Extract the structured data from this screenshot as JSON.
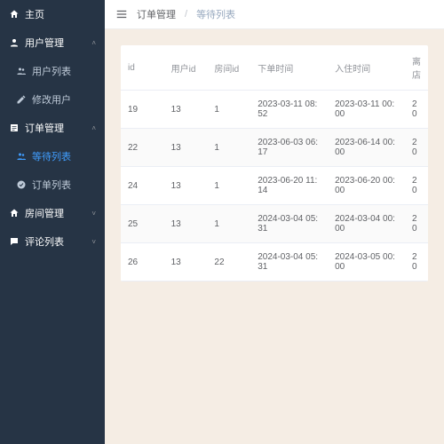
{
  "sidebar": {
    "home": "主页",
    "userMgmt": "用户管理",
    "userList": "用户列表",
    "editUser": "修改用户",
    "orderMgmt": "订单管理",
    "waitList": "等待列表",
    "orderList": "订单列表",
    "roomMgmt": "房间管理",
    "commentList": "评论列表"
  },
  "breadcrumb": {
    "a": "订单管理",
    "b": "等待列表"
  },
  "table": {
    "headers": {
      "id": "id",
      "uid": "用户id",
      "rid": "房间id",
      "order": "下单时间",
      "checkin": "入住时间",
      "checkout": "离店"
    },
    "rows": [
      {
        "id": "19",
        "uid": "13",
        "rid": "1",
        "order": "2023-03-11 08:52",
        "checkin": "2023-03-11 00:00",
        "checkout": "20"
      },
      {
        "id": "22",
        "uid": "13",
        "rid": "1",
        "order": "2023-06-03 06:17",
        "checkin": "2023-06-14 00:00",
        "checkout": "20"
      },
      {
        "id": "24",
        "uid": "13",
        "rid": "1",
        "order": "2023-06-20 11:14",
        "checkin": "2023-06-20 00:00",
        "checkout": "20"
      },
      {
        "id": "25",
        "uid": "13",
        "rid": "1",
        "order": "2024-03-04 05:31",
        "checkin": "2024-03-04 00:00",
        "checkout": "20"
      },
      {
        "id": "26",
        "uid": "13",
        "rid": "22",
        "order": "2024-03-04 05:31",
        "checkin": "2024-03-05 00:00",
        "checkout": "20"
      }
    ]
  }
}
